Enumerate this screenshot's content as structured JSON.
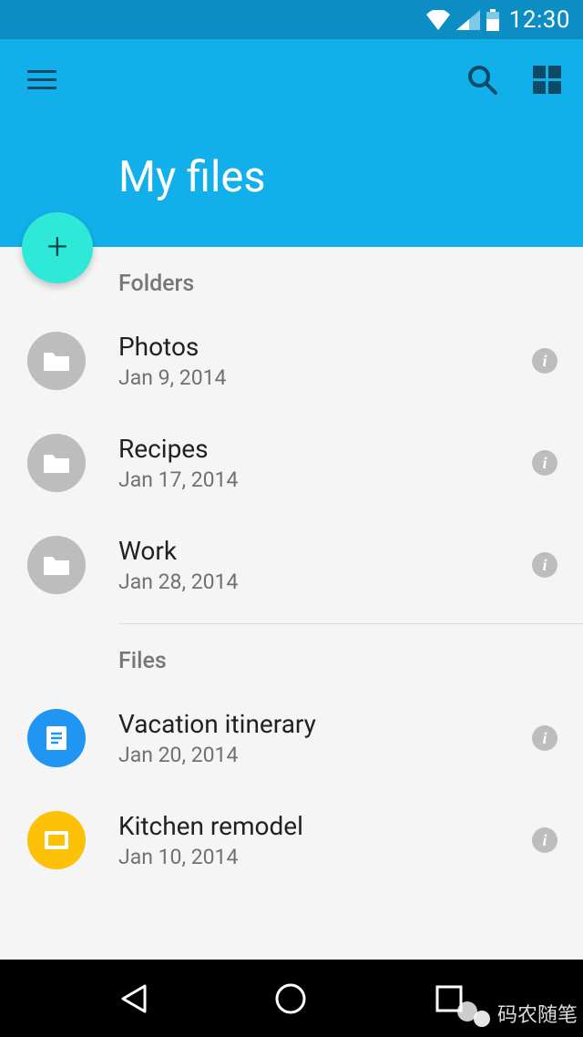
{
  "status": {
    "time": "12:30"
  },
  "app": {
    "title": "My files"
  },
  "sections": {
    "folders_label": "Folders",
    "files_label": "Files"
  },
  "folders": [
    {
      "name": "Photos",
      "date": "Jan 9, 2014"
    },
    {
      "name": "Recipes",
      "date": "Jan 17, 2014"
    },
    {
      "name": "Work",
      "date": "Jan 28, 2014"
    }
  ],
  "files": [
    {
      "name": "Vacation itinerary",
      "date": "Jan 20, 2014",
      "color": "blue"
    },
    {
      "name": "Kitchen remodel",
      "date": "Jan 10, 2014",
      "color": "yellow"
    }
  ],
  "watermark": {
    "text": "码农随笔"
  }
}
